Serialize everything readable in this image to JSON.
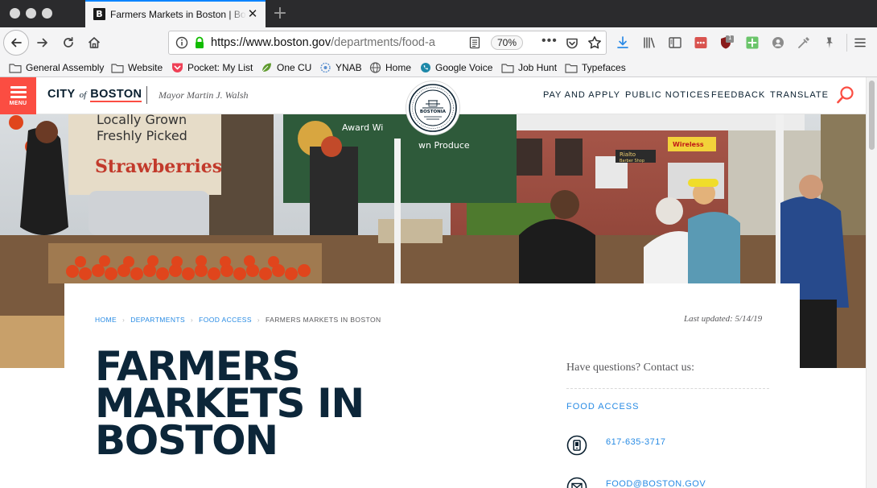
{
  "colors": {
    "accent_red": "#fb4d42",
    "navy": "#091f2f",
    "link_blue": "#288be4",
    "firefox_blue": "#0a84ff"
  },
  "browser": {
    "traffic_lights": [
      "close",
      "minimize",
      "zoom"
    ],
    "tab": {
      "favicon_letter": "B",
      "title": "Farmers Markets in Boston | Bo",
      "close_icon": "close-icon"
    },
    "new_tab_icon": "plus-icon",
    "nav": {
      "back_icon": "back-arrow-icon",
      "forward_icon": "forward-arrow-icon",
      "reload_icon": "reload-icon",
      "home_icon": "home-icon"
    },
    "urlbar": {
      "url_host": "https://www.boston.gov",
      "url_path": "/departments/food-a",
      "zoom": "70%",
      "more_label": "•••"
    },
    "toolbar_icons": [
      "download-icon",
      "library-icon",
      "sidebar-icon",
      "lastpass-icon",
      "ublock-icon",
      "extension-plus-icon",
      "account-icon",
      "eyedropper-icon",
      "pinterest-icon",
      "hamburger-menu-icon"
    ],
    "toolbar_badge": "1",
    "bookmarks": [
      {
        "label": "General Assembly",
        "icon": "folder-icon"
      },
      {
        "label": "Website",
        "icon": "folder-icon"
      },
      {
        "label": "Pocket: My List",
        "icon": "pocket-icon"
      },
      {
        "label": "One CU",
        "icon": "leaf-icon"
      },
      {
        "label": "YNAB",
        "icon": "ynab-icon"
      },
      {
        "label": "Home",
        "icon": "globe-icon"
      },
      {
        "label": "Google Voice",
        "icon": "google-voice-icon"
      },
      {
        "label": "Job Hunt",
        "icon": "folder-icon"
      },
      {
        "label": "Typefaces",
        "icon": "folder-icon"
      }
    ]
  },
  "site": {
    "menu_label": "MENU",
    "logo": {
      "city": "CITY",
      "of": "of",
      "boston": "BOSTON"
    },
    "mayor": "Mayor Martin J. Walsh",
    "seal_text": "BOSTONIA",
    "nav": [
      "PAY AND APPLY",
      "PUBLIC NOTICES",
      "FEEDBACK",
      "TRANSLATE"
    ],
    "hero_signs": {
      "sign1_line1": "Locally Grown",
      "sign1_line2": "Freshly Picked",
      "sign1_line3": "Strawberries",
      "sign2": "Award Wi",
      "sign3": "wn Produce",
      "sign4": "Rialto",
      "sign5": "Barber Shop",
      "sign6": "Wireless"
    },
    "breadcrumb": [
      "HOME",
      "DEPARTMENTS",
      "FOOD ACCESS",
      "FARMERS MARKETS IN BOSTON"
    ],
    "last_updated": "Last updated: 5/14/19",
    "page_title_lines": [
      "FARMERS",
      "MARKETS IN",
      "BOSTON"
    ],
    "contact": {
      "heading": "Have questions? Contact us:",
      "org": "FOOD ACCESS",
      "phone": "617-635-3717",
      "email": "FOOD@BOSTON.GOV"
    }
  }
}
